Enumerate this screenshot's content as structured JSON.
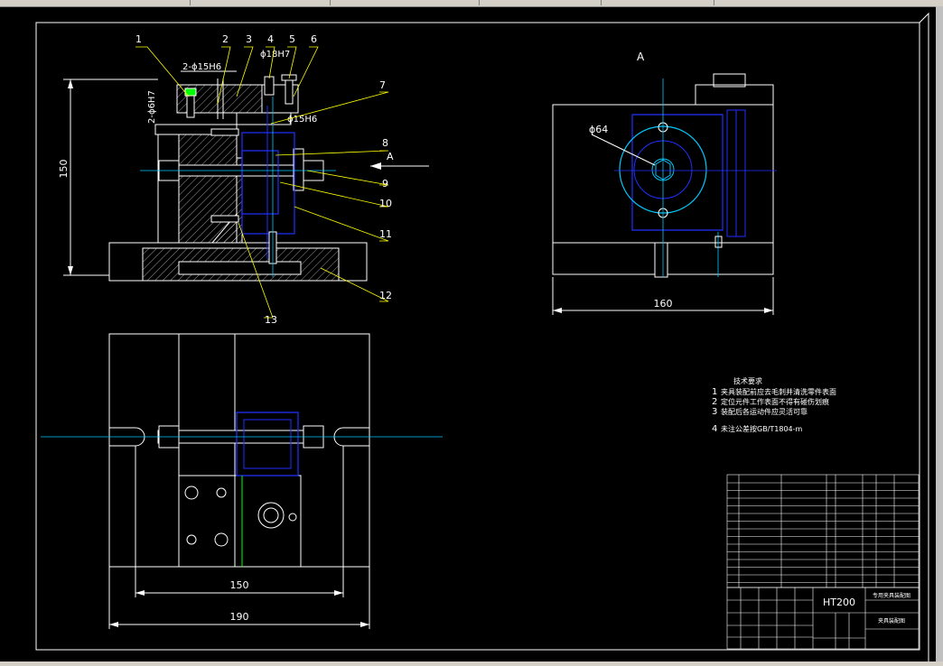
{
  "view_a_label": "A",
  "arrow_label": "A",
  "dims": {
    "height_150": "150",
    "top_width_160": "160",
    "bottom_inner_150": "150",
    "bottom_outer_190": "190",
    "phi64": "ϕ64",
    "phi18h7": "ϕ18H7",
    "phi15h6_top": "2-ϕ15H6",
    "phi15h6_side": "ϕ15H6",
    "phi6h7_side": "2-ϕ6H7"
  },
  "callouts": [
    "1",
    "2",
    "3",
    "4",
    "5",
    "6",
    "7",
    "8",
    "9",
    "10",
    "11",
    "12",
    "13"
  ],
  "notes": {
    "title": "技术要求",
    "items": [
      {
        "num": "1",
        "text": "夹具装配前应去毛刺并清洗零件表面"
      },
      {
        "num": "2",
        "text": "定位元件工作表面不得有碰伤划痕"
      },
      {
        "num": "3",
        "text": "装配后各运动件应灵活可靠"
      },
      {
        "num": "4",
        "text": "未注公差按GB/T1804-m"
      }
    ]
  },
  "title_block": {
    "material": "HT200",
    "title_right_top": "专用夹具装配图",
    "title_right_mid": "夹具装配图"
  },
  "colors": {
    "white": "#ffffff",
    "yellow": "#ffff00",
    "blue": "#2030ff",
    "cyan": "#00c8ff",
    "green": "#00ff00",
    "red": "#ff2020"
  }
}
